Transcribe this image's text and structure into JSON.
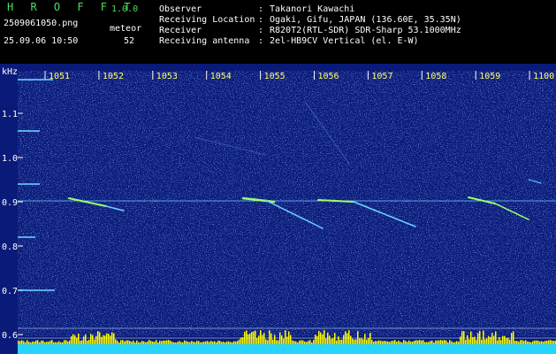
{
  "header": {
    "app_title": "H R O F F T",
    "app_version": "1.0.0",
    "file_name": "2509061050.png",
    "timestamp": "25.09.06 10:50",
    "meteor_label": "meteor",
    "meteor_count": "52",
    "info": [
      {
        "label": "Observer",
        "value": "Takanori Kawachi"
      },
      {
        "label": "Receiving Location",
        "value": "Ogaki, Gifu, JAPAN (136.60E, 35.35N)"
      },
      {
        "label": "Receiver",
        "value": "R820T2(RTL-SDR) SDR-Sharp 53.1000MHz"
      },
      {
        "label": "Receiving antenna",
        "value": "2el-HB9CV Vertical (el. E-W)"
      }
    ],
    "separator": ":"
  },
  "spectrogram": {
    "y_unit": "kHz",
    "y_ticks": [
      "1.1",
      "1.0",
      "0.9",
      "0.8",
      "0.7",
      "0.6"
    ],
    "time_ticks": [
      "1051",
      "1052",
      "1053",
      "1054",
      "1055",
      "1056",
      "1057",
      "1058",
      "1059",
      "1100"
    ],
    "colors": {
      "background": "#0a1a78",
      "noise": "#3b63d8",
      "carrier": "#6ad0ff",
      "signal": "#9cff6a",
      "bars": "#ffff00",
      "floor": "#25d4ff",
      "axis_text": "#ffff66",
      "label_text": "#ffffff"
    }
  }
}
